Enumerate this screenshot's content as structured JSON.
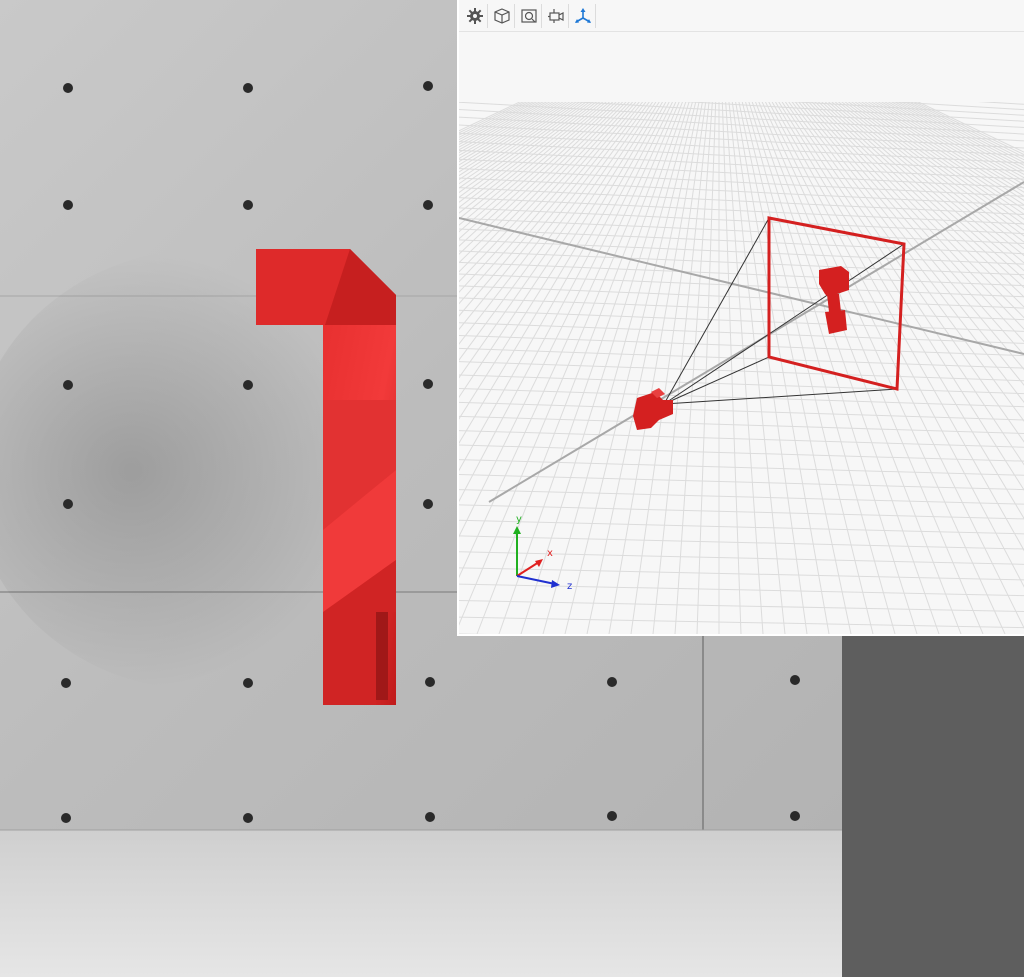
{
  "toolbar": {
    "buttons": [
      {
        "name": "settings",
        "icon": "gear-icon"
      },
      {
        "name": "view-cube",
        "icon": "cube-icon"
      },
      {
        "name": "render-snapshot",
        "icon": "camera-frame-icon"
      },
      {
        "name": "camera-rig",
        "icon": "camera-rig-icon"
      },
      {
        "name": "axis-gizmo",
        "icon": "axis-gizmo-icon",
        "active": true
      }
    ]
  },
  "axes": {
    "y_label": "y",
    "x_label": "x",
    "z_label": "z"
  },
  "colors": {
    "accent_red": "#d42020",
    "viewport_bg": "#f7f7f7",
    "grid_line": "#dcdcdc",
    "concrete": "#bdbdbd",
    "axis_x": "#e02020",
    "axis_y": "#20b020",
    "axis_z": "#2030d0",
    "active_icon": "#1e78d6"
  }
}
